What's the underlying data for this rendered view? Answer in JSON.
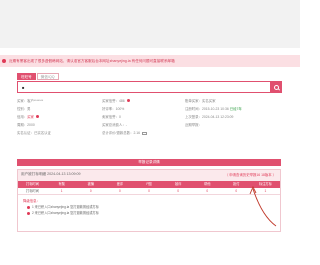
{
  "notice": {
    "text": "近期有黑客出现了很多虚假韩网站，请认准官方客服后台本网址zhanyejing.la 有任何问题可直接联系邮箱"
  },
  "tabs": [
    {
      "label": "旺旺号"
    },
    {
      "label": "微信/QQ"
    }
  ],
  "search": {
    "value": "■",
    "placeholder": ""
  },
  "info": {
    "row1": [
      {
        "label": "买家：",
        "value": "客户*******",
        "extra": ""
      },
      {
        "label": "买家信誉：",
        "value": "486 ",
        "extra": ""
      },
      {
        "label": "账单买家：",
        "value": "实名买家",
        "extra": ""
      }
    ],
    "row2": [
      {
        "label": "性别：",
        "value": "男",
        "extra": ""
      },
      {
        "label": "好评率：",
        "value": "100%",
        "extra": ""
      },
      {
        "label": "注册时间：",
        "value": "2015-10-23 10:36",
        "extra": "已经7年"
      }
    ],
    "row3": [
      {
        "label": "信用：",
        "value": "买家 ",
        "extra": ""
      },
      {
        "label": "卖家信誉：",
        "value": "0",
        "extra": ""
      },
      {
        "label": "上次登录：",
        "value": "2024-04-13 12:23:09",
        "extra": ""
      }
    ],
    "row4": [
      {
        "label": "周期：",
        "value": "2000",
        "extra": ""
      },
      {
        "label": "买家总消费人：",
        "value": "-",
        "extra": ""
      },
      {
        "label": "近期举报：",
        "value": "",
        "extra": ""
      }
    ],
    "row5": [
      {
        "label": "实名认证：",
        "value": "已实名认证",
        "extra": ""
      },
      {
        "label": "总计评价/退款总数：",
        "value": "2.16",
        "extra": ""
      },
      {
        "label": "",
        "value": "",
        "extra": ""
      }
    ]
  },
  "section": {
    "title": "举报记录详情"
  },
  "record": {
    "title": "用户被打标明细   2024-04-13 13:09:09",
    "badge": "1 查看记录",
    "link": "（ 申请查询历史举报16 18版本 ）",
    "headers": [
      "打标时间",
      "有冤",
      "被骗",
      "差评",
      "P图",
      "敲诈",
      "帮他",
      "拒付",
      "标注打标"
    ],
    "row": [
      "打标时间",
      "1",
      "0",
      "0",
      "0",
      "0",
      "0",
      "0",
      "1"
    ],
    "sub": "降级信息：",
    "lines": [
      "1 来已积入口zhanyejing.la 复打退款曾经或打标",
      "2 来已积入口zhanyejing.la 复打退款曾经或打标"
    ]
  }
}
